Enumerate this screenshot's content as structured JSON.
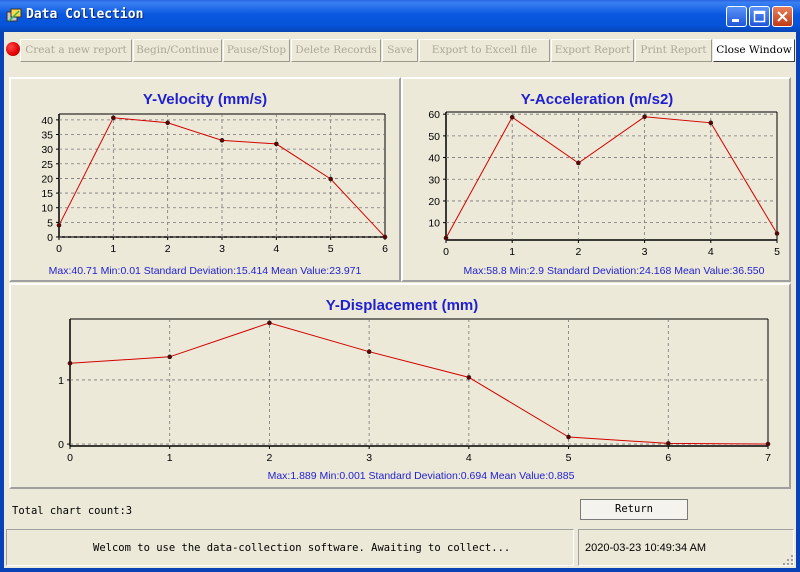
{
  "window": {
    "title": "Data Collection"
  },
  "toolbar": {
    "buttons": [
      {
        "label": "Creat a new report",
        "enabled": false
      },
      {
        "label": "Begin/Continue",
        "enabled": false
      },
      {
        "label": "Pause/Stop",
        "enabled": false
      },
      {
        "label": "Delete Records",
        "enabled": false
      },
      {
        "label": "Save",
        "enabled": false
      },
      {
        "label": "Export to Excell file",
        "enabled": false
      },
      {
        "label": "Export Report",
        "enabled": false
      },
      {
        "label": "Print Report",
        "enabled": false
      },
      {
        "label": "Close Window",
        "enabled": true
      }
    ]
  },
  "chart_data": [
    {
      "type": "line",
      "title": "Y-Velocity (mm/s)",
      "x": [
        0,
        1,
        2,
        3,
        4,
        5,
        6
      ],
      "values": [
        4,
        40.71,
        39,
        33,
        31.8,
        19.8,
        0.01
      ],
      "xlim": [
        0,
        6
      ],
      "ylim": [
        0,
        42
      ],
      "yticks": [
        0,
        5,
        10,
        15,
        20,
        25,
        30,
        35,
        40
      ],
      "xticks": [
        0,
        1,
        2,
        3,
        4,
        5,
        6
      ],
      "grid": true,
      "color": "#d40000",
      "stats": "Max:40.71  Min:0.01 Standard Deviation:15.414 Mean Value:23.971"
    },
    {
      "type": "line",
      "title": "Y-Acceleration (m/s2)",
      "x": [
        0,
        1,
        2,
        3,
        4,
        5
      ],
      "values": [
        2.9,
        58.6,
        37.5,
        58.8,
        56,
        5
      ],
      "xlim": [
        0,
        5
      ],
      "ylim": [
        2,
        61
      ],
      "yticks": [
        10,
        20,
        30,
        40,
        50,
        60
      ],
      "xticks": [
        0,
        1,
        2,
        3,
        4,
        5
      ],
      "grid": true,
      "color": "#d40000",
      "stats": "Max:58.8  Min:2.9 Standard Deviation:24.168 Mean Value:36.550"
    },
    {
      "type": "line",
      "title": "Y-Displacement (mm)",
      "x": [
        0,
        1,
        2,
        3,
        4,
        5,
        6,
        7
      ],
      "values": [
        1.26,
        1.36,
        1.889,
        1.44,
        1.04,
        0.11,
        0.01,
        0.001
      ],
      "xlim": [
        0,
        7
      ],
      "ylim": [
        -0.03,
        1.95
      ],
      "yticks": [
        0,
        1
      ],
      "xticks": [
        0,
        1,
        2,
        3,
        4,
        5,
        6,
        7
      ],
      "grid": true,
      "color": "#d40000",
      "stats": "Max:1.889  Min:0.001 Standard Deviation:0.694 Mean Value:0.885"
    }
  ],
  "info": {
    "chart_count": "Total chart count:3",
    "return_label": "Return"
  },
  "status": {
    "message": "Welcom to use the data-collection software. Awaiting to collect...",
    "datetime": "2020-03-23 10:49:34 AM"
  }
}
